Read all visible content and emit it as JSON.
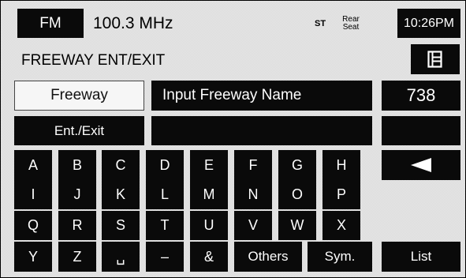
{
  "status_bar": {
    "band": "FM",
    "frequency": "100.3 MHz",
    "stereo": "ST",
    "rear_seat": "Rear Seat",
    "clock": "10:26PM"
  },
  "header": {
    "title": "FREEWAY ENT/EXIT",
    "icon": "map-book-icon"
  },
  "modes": {
    "freeway_label": "Freeway",
    "ent_exit_label": "Ent./Exit"
  },
  "input": {
    "prompt": "Input Freeway Name",
    "value": "",
    "count": "738"
  },
  "keyboard": {
    "row1": [
      "A",
      "B",
      "C",
      "D",
      "E",
      "F",
      "G",
      "H"
    ],
    "row2": [
      "I",
      "J",
      "K",
      "L",
      "M",
      "N",
      "O",
      "P"
    ],
    "row3": [
      "Q",
      "R",
      "S",
      "T",
      "U",
      "V",
      "W",
      "X"
    ],
    "row4": [
      "Y",
      "Z",
      "␣",
      "–",
      "&"
    ],
    "others_label": "Others",
    "sym_label": "Sym.",
    "list_label": "List",
    "backspace_icon": "backspace-arrow-icon"
  },
  "colors": {
    "key_background": "#0a0a0a",
    "key_text": "#ffffff",
    "selected_background": "#f6f6f6"
  }
}
